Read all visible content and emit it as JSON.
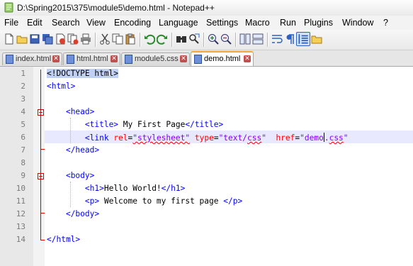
{
  "window": {
    "title": "D:\\Spring2015\\375\\module5\\demo.html - Notepad++"
  },
  "menu": [
    "File",
    "Edit",
    "Search",
    "View",
    "Encoding",
    "Language",
    "Settings",
    "Macro",
    "Run",
    "Plugins",
    "Window",
    "?"
  ],
  "toolbar": {
    "icons": [
      "new-file-icon",
      "open-folder-icon",
      "save-icon",
      "save-all-icon",
      "close-icon",
      "close-all-icon",
      "print-icon",
      "cut-icon",
      "copy-icon",
      "paste-icon",
      "undo-icon",
      "redo-icon",
      "find-icon",
      "replace-icon",
      "zoom-in-icon",
      "zoom-out-icon",
      "sync-vertical-icon",
      "sync-horizontal-icon",
      "word-wrap-icon",
      "show-all-chars-icon",
      "indent-guide-icon",
      "folder-icon"
    ]
  },
  "tabs": [
    {
      "label": "index.html",
      "active": false
    },
    {
      "label": "html.html",
      "active": false
    },
    {
      "label": "module5.css",
      "active": false
    },
    {
      "label": "demo.html",
      "active": true
    }
  ],
  "editor": {
    "current_line": 6,
    "lines": [
      {
        "n": "1",
        "parts": [
          {
            "t": "<!DOCTYPE html>",
            "c": "doctype"
          }
        ]
      },
      {
        "n": "2",
        "parts": [
          {
            "t": "<html>",
            "c": "tag"
          }
        ]
      },
      {
        "n": "3",
        "parts": []
      },
      {
        "n": "4",
        "parts": [
          {
            "t": "    ",
            "c": ""
          },
          {
            "t": "<head>",
            "c": "tag"
          }
        ]
      },
      {
        "n": "5",
        "parts": [
          {
            "t": "        ",
            "c": ""
          },
          {
            "t": "<title>",
            "c": "tag"
          },
          {
            "t": " My First Page",
            "c": ""
          },
          {
            "t": "</title>",
            "c": "tag"
          }
        ]
      },
      {
        "n": "6",
        "parts": [
          {
            "t": "        ",
            "c": ""
          },
          {
            "t": "<link ",
            "c": "tag"
          },
          {
            "t": "rel",
            "c": "attr"
          },
          {
            "t": "=",
            "c": ""
          },
          {
            "t": "\"stylesheet\"",
            "c": "str sq"
          },
          {
            "t": " ",
            "c": ""
          },
          {
            "t": "type",
            "c": "attr"
          },
          {
            "t": "=",
            "c": ""
          },
          {
            "t": "\"text/",
            "c": "str"
          },
          {
            "t": "css",
            "c": "str sq"
          },
          {
            "t": "\"",
            "c": "str"
          },
          {
            "t": "  ",
            "c": ""
          },
          {
            "t": "href",
            "c": "attr"
          },
          {
            "t": "=",
            "c": ""
          },
          {
            "t": "\"demo",
            "c": "str"
          },
          {
            "t": "",
            "c": "caret"
          },
          {
            "t": ".",
            "c": "str"
          },
          {
            "t": "css",
            "c": "str sq"
          },
          {
            "t": "\"",
            "c": "str"
          }
        ]
      },
      {
        "n": "7",
        "parts": [
          {
            "t": "    ",
            "c": ""
          },
          {
            "t": "</head>",
            "c": "tag"
          }
        ]
      },
      {
        "n": "8",
        "parts": []
      },
      {
        "n": "9",
        "parts": [
          {
            "t": "    ",
            "c": ""
          },
          {
            "t": "<body>",
            "c": "tag"
          }
        ]
      },
      {
        "n": "10",
        "parts": [
          {
            "t": "        ",
            "c": ""
          },
          {
            "t": "<h1>",
            "c": "tag"
          },
          {
            "t": "Hello World!",
            "c": ""
          },
          {
            "t": "</h1>",
            "c": "tag"
          }
        ]
      },
      {
        "n": "11",
        "parts": [
          {
            "t": "        ",
            "c": ""
          },
          {
            "t": "<p>",
            "c": "tag"
          },
          {
            "t": " Welcome to my first page ",
            "c": ""
          },
          {
            "t": "</p>",
            "c": "tag"
          }
        ]
      },
      {
        "n": "12",
        "parts": [
          {
            "t": "    ",
            "c": ""
          },
          {
            "t": "</body>",
            "c": "tag"
          }
        ]
      },
      {
        "n": "13",
        "parts": []
      },
      {
        "n": "14",
        "parts": [
          {
            "t": "</html>",
            "c": "tag"
          }
        ]
      }
    ]
  },
  "colors": {
    "tag": "#0000ff",
    "attribute": "#ff0000",
    "string": "#8000ff",
    "current_line": "#e8e8ff",
    "fold_marker": "#d20000",
    "active_tab_accent": "#f3a73b"
  }
}
